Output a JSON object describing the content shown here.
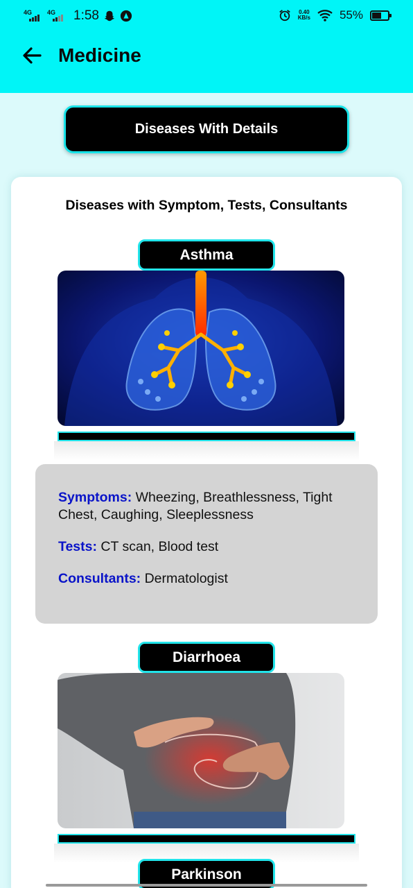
{
  "status_bar": {
    "network1": "4G",
    "network2": "4G",
    "time": "1:58",
    "speed_value": "0.40",
    "speed_unit": "KB/s",
    "battery": "55%"
  },
  "app_bar": {
    "title": "Medicine",
    "back_icon": "arrow-left-icon"
  },
  "main_button": {
    "label": "Diseases With Details"
  },
  "section": {
    "heading": "Diseases with Symptom, Tests, Consultants"
  },
  "diseases": [
    {
      "name": "Asthma",
      "symptoms_label": "Symptoms:",
      "symptoms": "Wheezing, Breathlessness, Tight Chest, Caughing, Sleeplessness",
      "tests_label": "Tests:",
      "tests": "CT scan, Blood test",
      "consultants_label": "Consultants:",
      "consultants": "Dermatologist"
    },
    {
      "name": "Diarrhoea"
    },
    {
      "name": "Parkinson"
    }
  ],
  "colors": {
    "app_bar": "#00f5f7",
    "page_bg": "#dcfafb",
    "accent_border": "#22e4ea",
    "label_blue": "#0a14c8",
    "details_bg": "#d4d4d4"
  }
}
